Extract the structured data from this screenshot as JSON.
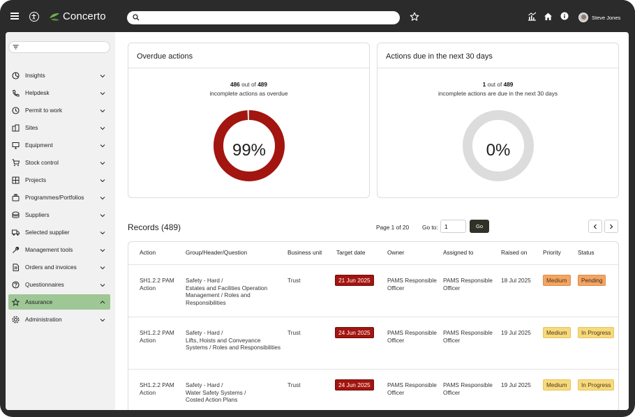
{
  "app": {
    "name": "Concerto",
    "user_name": "Steve Jones",
    "search_placeholder": ""
  },
  "sidebar": {
    "filter_placeholder": "",
    "items": [
      {
        "label": "Insights",
        "icon": "insights-icon"
      },
      {
        "label": "Helpdesk",
        "icon": "phone-icon"
      },
      {
        "label": "Permit to work",
        "icon": "clock-icon"
      },
      {
        "label": "Sites",
        "icon": "buildings-icon"
      },
      {
        "label": "Equipment",
        "icon": "monitor-icon"
      },
      {
        "label": "Stock control",
        "icon": "cart-icon"
      },
      {
        "label": "Projects",
        "icon": "grid-icon"
      },
      {
        "label": "Programmes/Portfolios",
        "icon": "stack-icon"
      },
      {
        "label": "Suppliers",
        "icon": "coins-icon"
      },
      {
        "label": "Selected supplier",
        "icon": "truck-icon"
      },
      {
        "label": "Management tools",
        "icon": "tools-icon"
      },
      {
        "label": "Orders and invoices",
        "icon": "document-icon"
      },
      {
        "label": "Questionnaires",
        "icon": "question-icon"
      },
      {
        "label": "Assurance",
        "icon": "star-icon",
        "active": true
      },
      {
        "label": "Administration",
        "icon": "gear-icon"
      }
    ]
  },
  "cards": {
    "overdue": {
      "title": "Overdue actions",
      "count": "486",
      "out_of_text": "out of",
      "total": "489",
      "subtitle": "incomplete actions as overdue",
      "percent_label": "99%",
      "percent_value": 99,
      "color": "#a3150f"
    },
    "due": {
      "title": "Actions due in the next 30 days",
      "count": "1",
      "out_of_text": "out of",
      "total": "489",
      "subtitle": "incomplete actions are due in the next 30 days",
      "percent_label": "0%",
      "percent_value": 0,
      "color": "#a3150f"
    }
  },
  "records": {
    "title": "Records (489)",
    "page_info": "Page 1 of 20",
    "goto_label": "Go to:",
    "goto_value": "1",
    "go_label": "Go",
    "columns": [
      "Action",
      "Group/Header/Question",
      "Business unit",
      "Target date",
      "Owner",
      "Assigned to",
      "Raised on",
      "Priority",
      "Status"
    ],
    "rows": [
      {
        "action": [
          "SH1.2.2 PAM",
          "Action"
        ],
        "group": [
          "Safety - Hard /",
          "Estates and Facilities Operation",
          "Management / Roles and",
          "Responsibilities"
        ],
        "business_unit": "Trust",
        "target_date": "21 Jun 2025",
        "owner": [
          "PAMS Responsible",
          "Officer"
        ],
        "assigned_to": [
          "PAMS Responsible",
          "Officer"
        ],
        "raised_on": "18 Jul 2025",
        "priority": "Medium",
        "status": "Pending"
      },
      {
        "action": [
          "SH1.2.2 PAM",
          "Action"
        ],
        "group": [
          "Safety - Hard /",
          "Lifts, Hoists and Conveyance",
          "Systems / Roles and Responsibilities"
        ],
        "business_unit": "Trust",
        "target_date": "24 Jun 2025",
        "owner": [
          "PAMS Responsible",
          "Officer"
        ],
        "assigned_to": [
          "PAMS Responsible",
          "Officer"
        ],
        "raised_on": "19 Jul 2025",
        "priority": "Medium",
        "status": "In Progress"
      },
      {
        "action": [
          "SH1.2.2 PAM",
          "Action"
        ],
        "group": [
          "Safety - Hard /",
          "Water Safety Systems /",
          "Costed Action Plans"
        ],
        "business_unit": "Trust",
        "target_date": "24 Jun 2025",
        "owner": [
          "PAMS Responsible",
          "Officer"
        ],
        "assigned_to": [
          "PAMS Responsible",
          "Officer"
        ],
        "raised_on": "19 Jul 2025",
        "priority": "Medium",
        "status": "In Progress"
      }
    ]
  }
}
